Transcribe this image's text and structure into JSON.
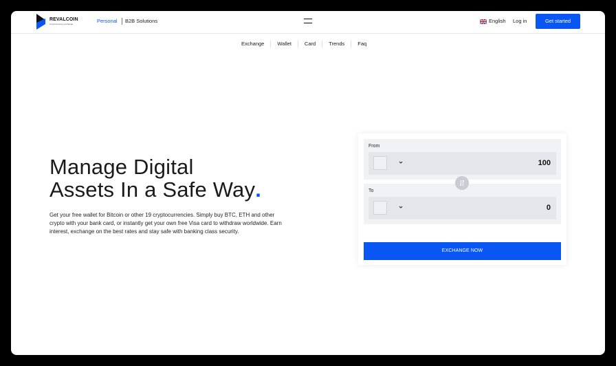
{
  "brand": {
    "name": "REVALCOIN",
    "tagline": "Cryptocurrency exchange",
    "color": "#0a56f5"
  },
  "header": {
    "segments": [
      {
        "label": "Personal",
        "active": true
      },
      {
        "label": "B2B Solutions",
        "active": false
      }
    ],
    "menu_icon": "hamburger-icon",
    "language": {
      "label": "English",
      "flag_icon": "uk-flag-icon"
    },
    "login_label": "Log in",
    "cta_label": "Get started"
  },
  "nav": {
    "items": [
      "Exchange",
      "Wallet",
      "Card",
      "Trends",
      "Faq"
    ]
  },
  "hero": {
    "title_line1": "Manage Digital",
    "title_line2": "Assets In a Safe Way",
    "title_dot": ".",
    "description": "Get your free wallet for Bitcoin or other 19 cryptocurrencies. Simply buy BTC, ETH and other crypto with your bank card, or instantly get your own free Visa card to withdraw worldwide. Earn interest, exchange on the best rates and stay safe with banking class security."
  },
  "exchange": {
    "from": {
      "label": "From",
      "amount": "100",
      "coin_icon": "coin-placeholder-icon"
    },
    "to": {
      "label": "To",
      "amount": "0",
      "coin_icon": "coin-placeholder-icon"
    },
    "swap_icon": "swap-arrows-icon",
    "button_label": "EXCHANGE NOW"
  }
}
